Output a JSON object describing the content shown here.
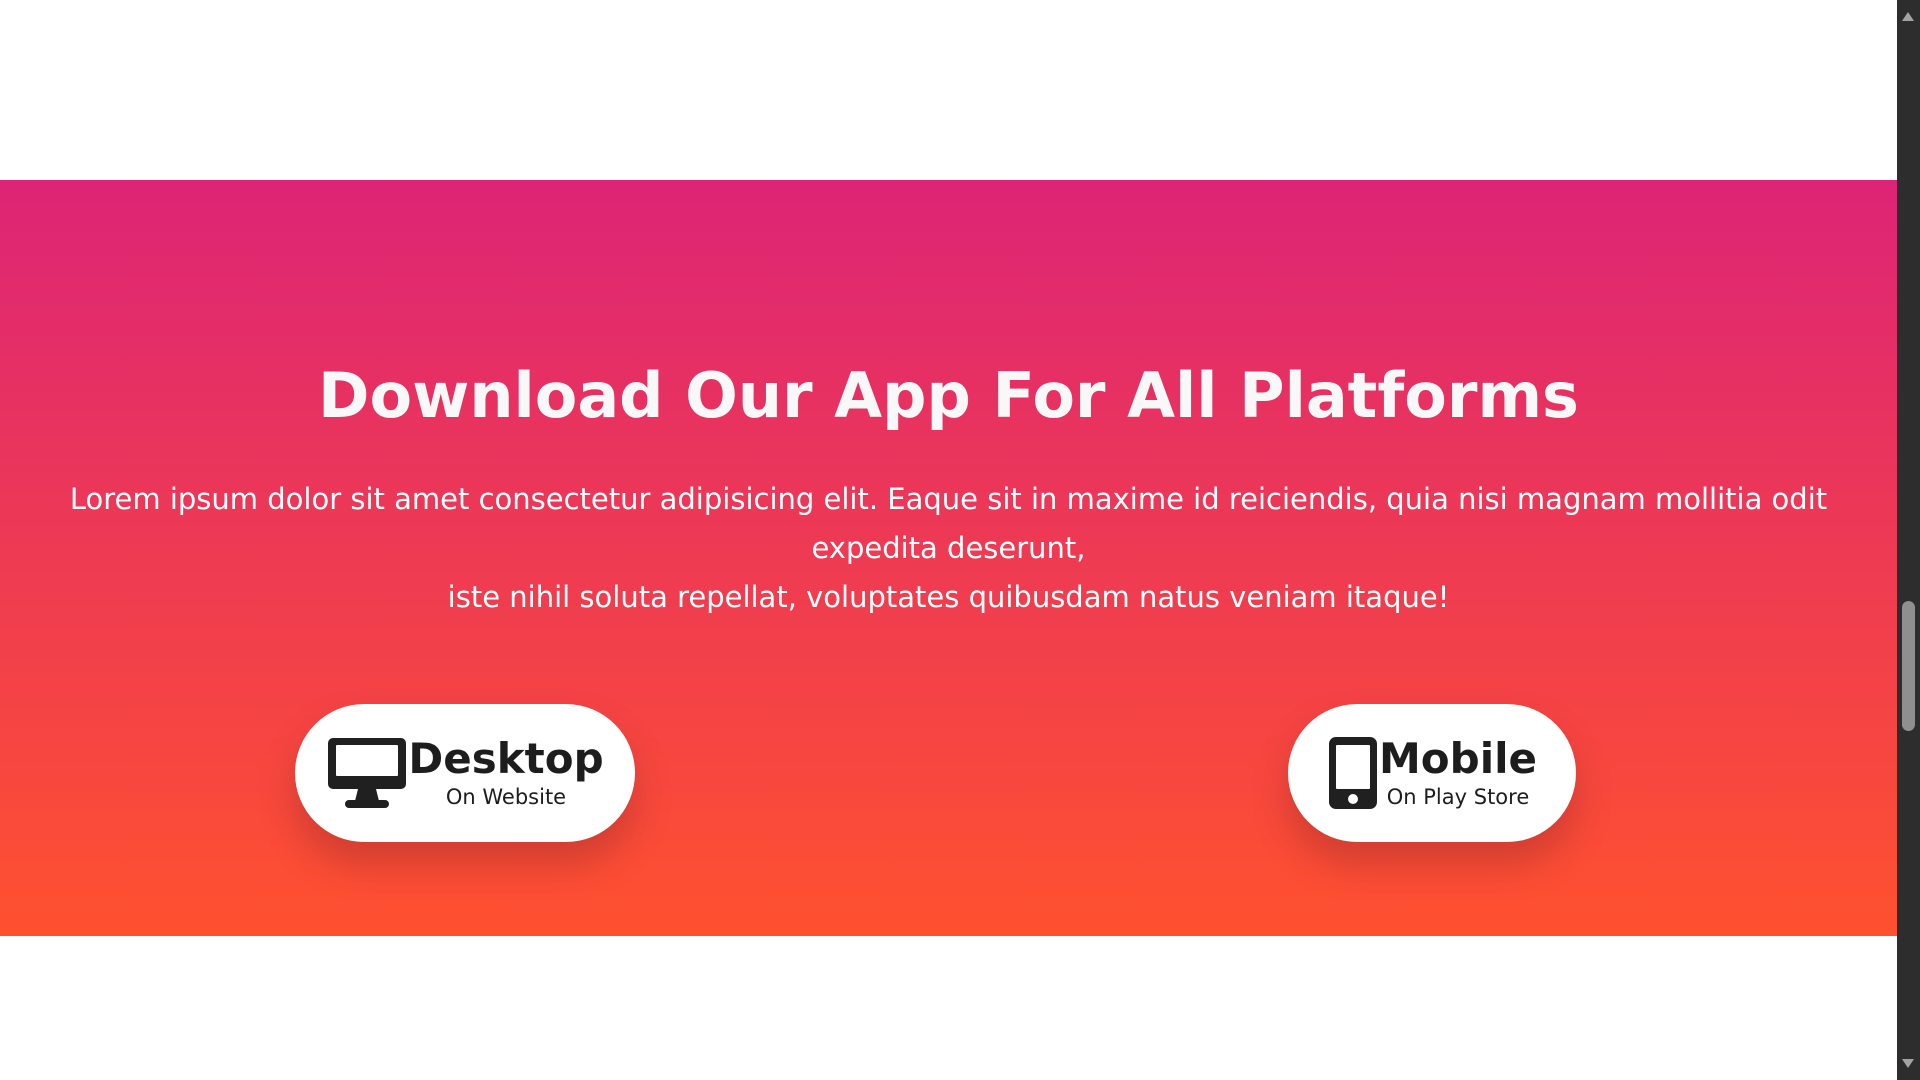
{
  "download": {
    "title": "Download Our App For All Platforms",
    "description_line_1": "Lorem ipsum dolor sit amet consectetur adipisicing elit. Eaque sit in maxime id reiciendis, quia nisi magnam mollitia odit expedita deserunt,",
    "description_line_2": "iste nihil soluta repellat, voluptates quibusdam natus veniam itaque!",
    "gradient_top": "#dd2476",
    "gradient_bottom": "#ff512f",
    "buttons": [
      {
        "icon": "desktop-monitor-icon",
        "label": "Desktop",
        "sublabel": "On Website"
      },
      {
        "icon": "mobile-phone-icon",
        "label": "Mobile",
        "sublabel": "On Play Store"
      }
    ]
  },
  "browser": {
    "scrollbar_icons": [
      "scroll-up-arrow-icon",
      "scroll-down-arrow-icon"
    ]
  }
}
